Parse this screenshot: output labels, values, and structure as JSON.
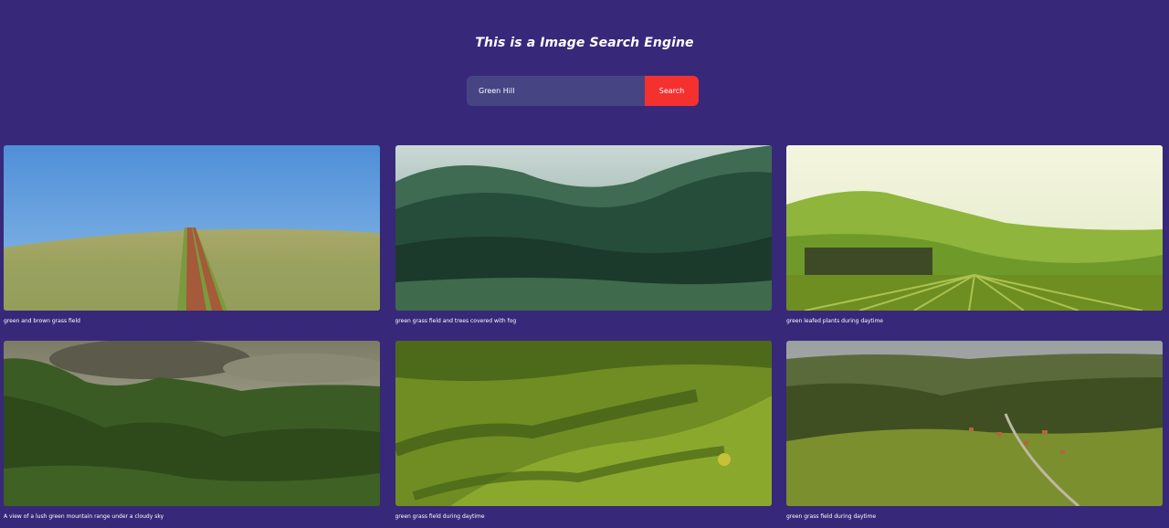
{
  "header": {
    "title": "This is a Image Search Engine"
  },
  "search": {
    "value": "Green Hill",
    "placeholder": "Green Hill",
    "button_label": "Search",
    "button_color": "#f4312f",
    "input_color": "#474484"
  },
  "colors": {
    "background": "#37287a"
  },
  "results": [
    {
      "caption": "green and brown grass field"
    },
    {
      "caption": "green grass field and trees covered with fog"
    },
    {
      "caption": "green leafed plants during daytime"
    },
    {
      "caption": "A view of a lush green mountain range under a cloudy sky"
    },
    {
      "caption": "green grass field during daytime"
    },
    {
      "caption": "green grass field during daytime"
    }
  ]
}
